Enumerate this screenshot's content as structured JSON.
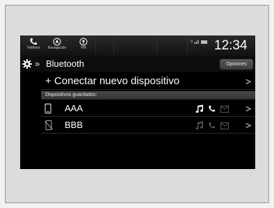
{
  "status_bar": {
    "apps": [
      {
        "label": "Teléfono",
        "icon": "phone-icon"
      },
      {
        "label": "Navegación",
        "icon": "navigation-icon"
      },
      {
        "label": "FM",
        "icon": "radio-icon"
      }
    ],
    "indicators": "0",
    "clock": "12:34"
  },
  "header": {
    "breadcrumb_separator": "»",
    "title": "Bluetooth",
    "options_label": "Opciones"
  },
  "connect_row": {
    "label": "+ Conectar nuevo dispositivo",
    "chevron": ">"
  },
  "saved_section": {
    "label": "Dispositivos guardados:"
  },
  "devices": [
    {
      "name": "AAA",
      "icon": "phone-connected-icon",
      "audio_active": true,
      "phone_active": true,
      "chevron": ">"
    },
    {
      "name": "BBB",
      "icon": "phone-disconnected-icon",
      "audio_active": false,
      "phone_active": false,
      "chevron": ">"
    }
  ],
  "colors": {
    "active_capability": "#ffffff",
    "inactive_capability": "#555555",
    "background": "#000000"
  }
}
